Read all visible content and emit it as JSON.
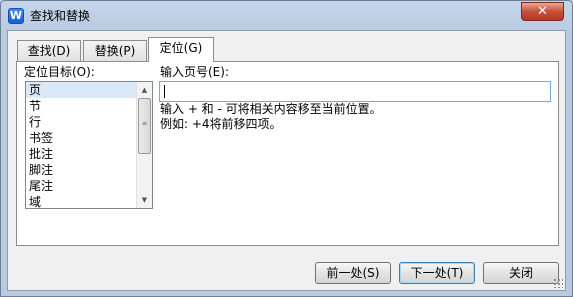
{
  "window": {
    "title": "查找和替换",
    "close_glyph": "✕",
    "app_icon_letter": "W"
  },
  "tabs": [
    {
      "label": "查找(D)",
      "active": false
    },
    {
      "label": "替换(P)",
      "active": false
    },
    {
      "label": "定位(G)",
      "active": true
    }
  ],
  "goto": {
    "target_label": "定位目标(O):",
    "targets": [
      "页",
      "节",
      "行",
      "书签",
      "批注",
      "脚注",
      "尾注",
      "域"
    ],
    "selected_target": "页",
    "input_label": "输入页号(E):",
    "input_value": "",
    "hint_line1": "输入 + 和 - 可将相关内容移至当前位置。",
    "hint_line2": "例如: +4将前移四项。"
  },
  "buttons": {
    "previous": "前一处(S)",
    "next": "下一处(T)",
    "close": "关闭"
  }
}
